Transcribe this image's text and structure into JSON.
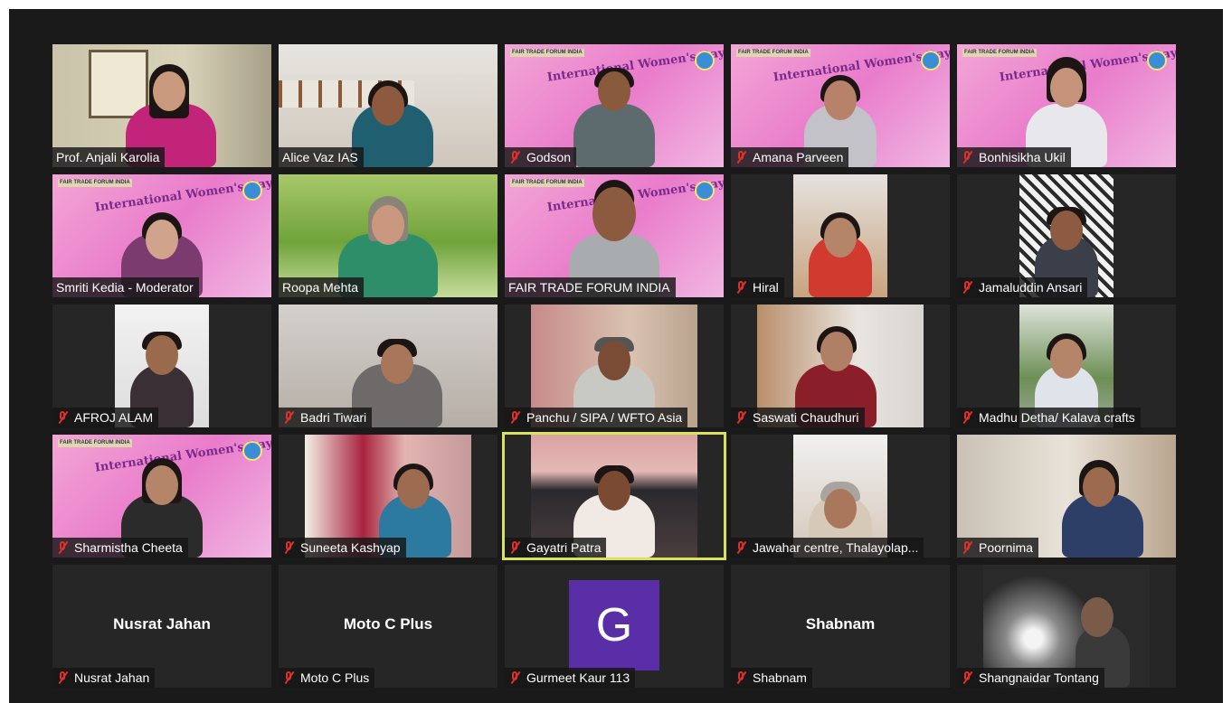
{
  "meeting": {
    "banner_text": "International Women's Day",
    "banner_badge": "FAIR TRADE FORUM INDIA",
    "colors": {
      "background": "#1a1a1a",
      "tile": "#262626",
      "active_speaker_border": "#d7e35a",
      "muted_icon": "#e0302a",
      "avatar": "#5a2ea6"
    }
  },
  "participants": [
    {
      "name": "Prof. Anjali Karolia",
      "muted": false
    },
    {
      "name": "Alice Vaz IAS",
      "muted": false
    },
    {
      "name": "Godson",
      "muted": true
    },
    {
      "name": "Amana Parveen",
      "muted": true
    },
    {
      "name": "Bonhisikha Ukil",
      "muted": true
    },
    {
      "name": "Smriti Kedia - Moderator",
      "muted": false
    },
    {
      "name": "Roopa Mehta",
      "muted": false
    },
    {
      "name": "FAIR TRADE FORUM INDIA",
      "muted": false
    },
    {
      "name": "Hiral",
      "muted": true
    },
    {
      "name": "Jamaluddin Ansari",
      "muted": true
    },
    {
      "name": "AFROJ ALAM",
      "muted": true
    },
    {
      "name": "Badri Tiwari",
      "muted": true
    },
    {
      "name": "Panchu / SIPA / WFTO Asia",
      "muted": true
    },
    {
      "name": "Saswati Chaudhuri",
      "muted": true
    },
    {
      "name": "Madhu Detha/ Kalava crafts",
      "muted": true
    },
    {
      "name": "Sharmistha Cheeta",
      "muted": true
    },
    {
      "name": "Suneeta Kashyap",
      "muted": true
    },
    {
      "name": "Gayatri Patra",
      "muted": true,
      "active_speaker": true
    },
    {
      "name": "Jawahar centre, Thalayolap...",
      "muted": true
    },
    {
      "name": "Poornima",
      "muted": true
    },
    {
      "name": "Nusrat Jahan",
      "muted": true,
      "video_off": true,
      "center_text": "Nusrat Jahan"
    },
    {
      "name": "Moto C Plus",
      "muted": true,
      "video_off": true,
      "center_text": "Moto C Plus"
    },
    {
      "name": "Gurmeet Kaur 113",
      "muted": true,
      "video_off": true,
      "avatar_letter": "G"
    },
    {
      "name": "Shabnam",
      "muted": true,
      "video_off": true,
      "center_text": "Shabnam"
    },
    {
      "name": "Shangnaidar Tontang",
      "muted": true
    }
  ]
}
